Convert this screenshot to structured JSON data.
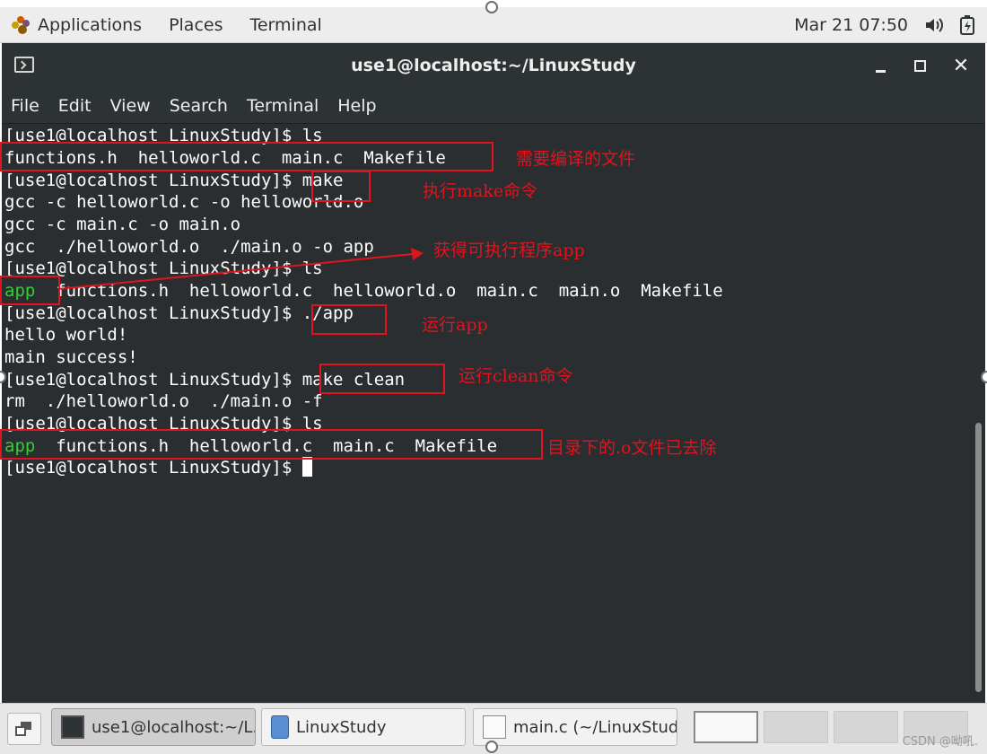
{
  "top_panel": {
    "applications": "Applications",
    "places": "Places",
    "terminal": "Terminal",
    "clock": "Mar 21  07:50",
    "volume_icon": "speaker-icon",
    "battery_icon": "battery-icon"
  },
  "window": {
    "title": "use1@localhost:~/LinuxStudy",
    "menu": [
      "File",
      "Edit",
      "View",
      "Search",
      "Terminal",
      "Help"
    ]
  },
  "terminal": {
    "lines": [
      "[use1@localhost LinuxStudy]$ ls",
      "functions.h  helloworld.c  main.c  Makefile",
      "[use1@localhost LinuxStudy]$ make",
      "gcc -c helloworld.c -o helloworld.o",
      "gcc -c main.c -o main.o",
      "gcc  ./helloworld.o  ./main.o -o app",
      "[use1@localhost LinuxStudy]$ ls",
      "",
      "[use1@localhost LinuxStudy]$ ./app",
      "hello world!",
      "main success!",
      "[use1@localhost LinuxStudy]$ make clean",
      "rm  ./helloworld.o  ./main.o -f",
      "[use1@localhost LinuxStudy]$ ls",
      "",
      "[use1@localhost LinuxStudy]$ "
    ],
    "ls2_green": "app",
    "ls2_rest": "  functions.h  helloworld.c  helloworld.o  main.c  main.o  Makefile",
    "ls3_green": "app",
    "ls3_rest": "  functions.h  helloworld.c  main.c  Makefile"
  },
  "annotations": {
    "n1": "需要编译的文件",
    "n2": "执行make命令",
    "n3": "获得可执行程序app",
    "n4": "运行app",
    "n5": "运行clean命令",
    "n6": "目录下的.o文件已去除",
    "color": "#e0141e"
  },
  "taskbar": {
    "task1": "use1@localhost:~/L...",
    "task2": "LinuxStudy",
    "task3": "main.c (~/LinuxStud...",
    "watermark": "CSDN @呦吼."
  }
}
